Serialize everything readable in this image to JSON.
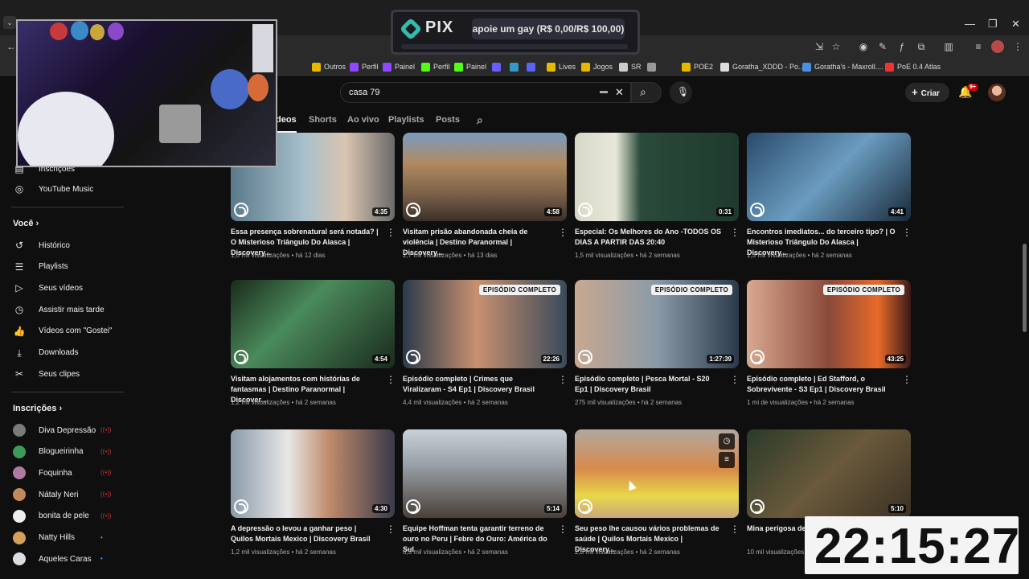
{
  "window_controls": {
    "minimize": "—",
    "restore": "❐",
    "close": "✕"
  },
  "bookmarks": [
    {
      "label": "Outros",
      "color": "#e6b800"
    },
    {
      "label": "Perfil",
      "color": "#9146ff"
    },
    {
      "label": "Painel",
      "color": "#9146ff"
    },
    {
      "label": "Perfil",
      "color": "#53fc18"
    },
    {
      "label": "Painel",
      "color": "#53fc18"
    },
    {
      "label": "",
      "color": "#6a5cff"
    },
    {
      "label": "",
      "color": "#39c"
    },
    {
      "label": "",
      "color": "#5865f2"
    },
    {
      "label": "Lives",
      "color": "#e6b800"
    },
    {
      "label": "Jogos",
      "color": "#e6b800"
    },
    {
      "label": "SR",
      "color": "#ccc"
    },
    {
      "label": "",
      "color": "#999"
    },
    {
      "label": "POE2",
      "color": "#e6b800"
    },
    {
      "label": "Goratha_XDDD - Po...",
      "color": "#ddd"
    },
    {
      "label": "Goratha's - Maxroll....",
      "color": "#4a90e2"
    },
    {
      "label": "PoE 0.4 Atlas",
      "color": "#e33"
    }
  ],
  "pix": {
    "title": "PIX",
    "pill": "apoie um gay (R$ 0,00/R$ 100,00)",
    "progress": 0
  },
  "search": {
    "query": "casa 79"
  },
  "header": {
    "create_label": "Criar",
    "notification_badge": "9+"
  },
  "chips": [
    "deos",
    "Shorts",
    "Ao vivo",
    "Playlists",
    "Posts"
  ],
  "sidebar": {
    "top_items": [
      {
        "label": "Inscrições",
        "icon": "subscriptions-icon"
      },
      {
        "label": "YouTube Music",
        "icon": "music-icon"
      }
    ],
    "you_heading": "Você",
    "you_items": [
      {
        "label": "Histórico",
        "icon": "history-icon"
      },
      {
        "label": "Playlists",
        "icon": "playlist-icon"
      },
      {
        "label": "Seus vídeos",
        "icon": "video-icon"
      },
      {
        "label": "Assistir mais tarde",
        "icon": "clock-icon"
      },
      {
        "label": "Vídeos com \"Gostei\"",
        "icon": "like-icon"
      },
      {
        "label": "Downloads",
        "icon": "download-icon"
      },
      {
        "label": "Seus clipes",
        "icon": "scissors-icon"
      }
    ],
    "subs_heading": "Inscrições",
    "subscriptions": [
      {
        "label": "Diva Depressão",
        "color": "#7a7a7a",
        "live": true
      },
      {
        "label": "Blogueirinha",
        "color": "#3c9a5a",
        "live": true
      },
      {
        "label": "Foquinha",
        "color": "#b07aa0",
        "live": true
      },
      {
        "label": "Nátaly Neri",
        "color": "#c28a5a",
        "live": true
      },
      {
        "label": "bonita de pele",
        "color": "#eeeeee",
        "live": true
      },
      {
        "label": "Natty Hills",
        "color": "#d4a05a",
        "live": false
      },
      {
        "label": "Aqueles Caras",
        "color": "#dddddd",
        "live": false
      }
    ]
  },
  "videos": [
    {
      "title": "Essa presença sobrenatural será notada? | O Misterioso Triângulo Do Alasca | Discovery...",
      "meta": "1,6 mil visualizações • há 12 dias",
      "duration": "4:35",
      "badge": "",
      "bg": "linear-gradient(90deg,#5a7a8a 0%,#a8c0cc 45%,#d9c4b0 70%,#6a6a6a 100%)"
    },
    {
      "title": "Visitam prisão abandonada cheia de violência | Destino Paranormal | Discovery...",
      "meta": "2,7 mil visualizações • há 13 dias",
      "duration": "4:58",
      "badge": "",
      "bg": "linear-gradient(180deg,#7a9cc0 0%,#b08a60 35%,#7a6048 70%,#3a3028 100%)"
    },
    {
      "title": "Especial: Os Melhores do Ano -TODOS OS DIAS A PARTIR DAS 20:40",
      "meta": "1,5 mil visualizações • há 2 semanas",
      "duration": "0:31",
      "badge": "",
      "bg": "linear-gradient(90deg,#d8d8c8 0%,#e8e8d8 25%,#2a4a3a 40%,#1e3a2e 100%)"
    },
    {
      "title": "Encontros imediatos... do terceiro tipo? | O Misterioso Triângulo Do Alasca | Discovery...",
      "meta": "1,3 mil visualizações • há 2 semanas",
      "duration": "4:41",
      "badge": "",
      "bg": "linear-gradient(135deg,#2a4a6a 0%,#6a9cc0 50%,#1a2a3a 100%)"
    },
    {
      "title": "Visitam alojamentos com histórias de fantasmas | Destino Paranormal | Discover...",
      "meta": "1,2 mil visualizações • há 2 semanas",
      "duration": "4:54",
      "badge": "",
      "bg": "linear-gradient(135deg,#1a2a1a 0%,#4a8a5a 40%,#1a2a1e 100%)"
    },
    {
      "title": "Episódio completo | Crimes que Viralizaram - S4 Ep1 | Discovery Brasil",
      "meta": "4,4 mil visualizações • há 2 semanas",
      "duration": "22:26",
      "badge": "EPISÓDIO COMPLETO",
      "bg": "linear-gradient(90deg,#2a3a4a 0%,#c89070 45%,#3a4a5a 100%)"
    },
    {
      "title": "Episódio completo | Pesca Mortal - S20 Ep1 | Discovery Brasil",
      "meta": "275 mil visualizações • há 2 semanas",
      "duration": "1:27:39",
      "badge": "EPISÓDIO COMPLETO",
      "bg": "linear-gradient(90deg,#c8a890 0%,#8a9aa8 50%,#2a3a4a 100%)"
    },
    {
      "title": "Episódio completo | Ed Stafford, o Sobrevivente - S3 Ep1 | Discovery Brasil",
      "meta": "1 mi de visualizações • há 2 semanas",
      "duration": "43:25",
      "badge": "EPISÓDIO COMPLETO",
      "bg": "linear-gradient(90deg,#d8a890 0%,#8a4a3a 50%,#e86a2a 80%,#3a1a1a 100%)"
    },
    {
      "title": "A depressão o levou a ganhar peso | Quilos Mortais Mexico | Discovery Brasil",
      "meta": "1,2 mil visualizações • há 2 semanas",
      "duration": "4:30",
      "badge": "",
      "bg": "linear-gradient(90deg,#8a9aaa 0%,#e8e8e8 35%,#c08a6a 60%,#3a3a4a 100%)"
    },
    {
      "title": "Equipe Hoffman tenta garantir terreno de ouro no Peru | Febre do Ouro: América do Sul",
      "meta": "6,3 mil visualizações • há 2 semanas",
      "duration": "5:14",
      "badge": "",
      "bg": "linear-gradient(180deg,#c8d0d8 0%,#9aa0a8 40%,#4a4038 100%)"
    },
    {
      "title": "Seu peso lhe causou vários problemas de saúde | Quilos Mortais Mexico | Discovery...",
      "meta": "2,8 mil visualizações • há 2 semanas",
      "duration": "",
      "badge": "",
      "hover": true,
      "bg": "linear-gradient(180deg,#b0a8a0 0%,#d88a4a 45%,#e8d84a 75%,#c8a878 100%)"
    },
    {
      "title": "Mina perigosa de... Febre do Ouro: A...",
      "meta": "10 mil visualizações • há 2 semanas",
      "duration": "5:10",
      "badge": "",
      "bg": "linear-gradient(135deg,#2a3a2a 0%,#6a5a3a 50%,#3a3024 100%)"
    }
  ],
  "clock": "22:15:27"
}
